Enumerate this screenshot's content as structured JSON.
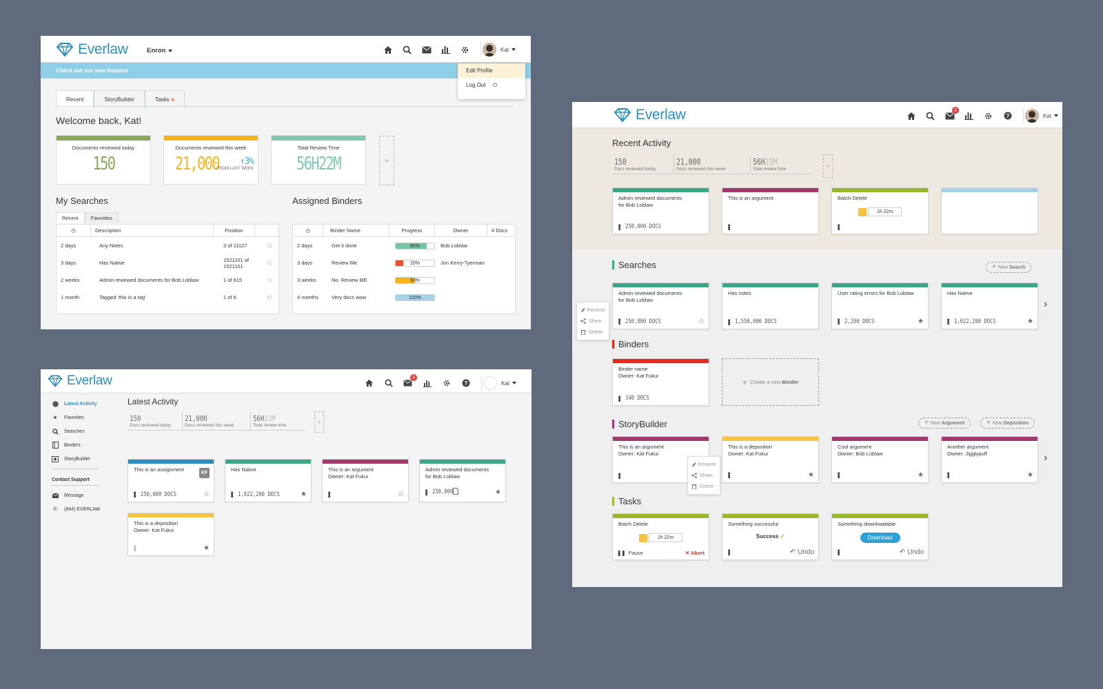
{
  "brand": {
    "name": "Everlaw",
    "color": "#2c8fbf"
  },
  "screen1": {
    "project": "Enron",
    "user": "Kat",
    "banner": "Check out our new features",
    "dropdown": [
      "Edit Profile",
      "Log Out"
    ],
    "tabs": [
      "Recent",
      "StoryBuilder",
      "Tasks"
    ],
    "welcome": "Welcome back, Kat!",
    "stats": [
      {
        "label": "Documents reviewed today",
        "value": "150",
        "color": "#8aa85a"
      },
      {
        "label": "Documents reviewed this week",
        "value": "21,000",
        "color": "#f6b41a",
        "delta": "3%",
        "delta_arrow": "↑",
        "delta_note": "FROM LAST WEEK"
      },
      {
        "label": "Total Review Time",
        "value": "56H22M",
        "color": "#7ec8b0"
      }
    ],
    "add": "+",
    "searches": {
      "title": "My Searches",
      "tabs": [
        "Recent",
        "Favorites"
      ],
      "headers": [
        "Description",
        "Position"
      ],
      "rows": [
        {
          "age": "2 days",
          "desc": "Any Notes",
          "pos": "3 of 11127"
        },
        {
          "age": "3 days",
          "desc": "Has Native",
          "pos": "1521101 of 1521101"
        },
        {
          "age": "2 weeks",
          "desc": "Admin reviewed documents for Bob Loblaw",
          "pos": "1 of 615"
        },
        {
          "age": "1 month",
          "desc": "Tagged 'this is a tag'",
          "pos": "1 of 6"
        }
      ]
    },
    "binders": {
      "title": "Assigned Binders",
      "headers": [
        "Binder Name",
        "Progress",
        "Owner",
        "# Docs"
      ],
      "rows": [
        {
          "age": "2 days",
          "name": "Get it done",
          "progress": 80,
          "progress_label": "80%",
          "color": "#74c6a3",
          "owner": "Bob Loblaw"
        },
        {
          "age": "3 days",
          "name": "Review Me",
          "progress": 20,
          "progress_label": "20%",
          "color": "#e8532f",
          "owner": "Jon Kerry-Tyerman"
        },
        {
          "age": "3 weeks",
          "name": "No, Review ME",
          "progress": 50,
          "progress_label": "50%",
          "color": "#f6b41a",
          "owner": ""
        },
        {
          "age": "4 months",
          "name": "Very docs wow",
          "progress": 100,
          "progress_label": "100%",
          "color": "#a7d3ea",
          "owner": ""
        }
      ]
    }
  },
  "screen2": {
    "user": "Kat",
    "mail_badge": "3",
    "nav": [
      "Latest Activity",
      "Favorites",
      "Searches",
      "Binders",
      "StoryBuilder"
    ],
    "contact": {
      "title": "Contact Support",
      "message": "Message",
      "phone": "(844) EVERLAW"
    },
    "title": "Latest Activity",
    "stats": [
      {
        "n": "150",
        "t": "Docs reviewed today"
      },
      {
        "n": "21,000",
        "t": "Docs reviewed this week"
      },
      {
        "n_dark": "56H",
        "n_light": "22M",
        "t": "Total review time"
      }
    ],
    "add": "+",
    "cards": [
      {
        "title": "This is an assignment",
        "sub": "",
        "color": "#2c8fbf",
        "docs": "250,000 DOCS",
        "badge": "KF",
        "star": "☆"
      },
      {
        "title": "Has Native",
        "sub": "",
        "color": "#3aa886",
        "docs": "1,022,200 DOCS",
        "star": "★"
      },
      {
        "title": "This is an argument",
        "sub": "Owner: Kat Fukui",
        "color": "#a2396d",
        "docs": "",
        "star": "☆"
      },
      {
        "title": "Admin reviewed documents",
        "sub": "for Bob Loblaw",
        "color": "#3aa886",
        "docs": "250,000",
        "star": "★"
      },
      {
        "title": "This is a deposition",
        "sub": "Owner: Kat Fukui",
        "color": "#f6c343",
        "docs": "",
        "star": "★"
      }
    ]
  },
  "screen3": {
    "user": "Kat",
    "mail_badge": "3",
    "recent_title": "Recent Activity",
    "stats": [
      {
        "n": "150",
        "t": "Docs reviewed today"
      },
      {
        "n": "21,000",
        "t": "Docs reviewed this week"
      },
      {
        "n_dark": "56H",
        "n_light": "22M",
        "t": "Total review time"
      }
    ],
    "add": "+",
    "recent_cards": [
      {
        "title": "Admin reviewed documents",
        "sub": "for Bob Loblaw",
        "color": "#3aa886",
        "docs": "250,000 DOCS"
      },
      {
        "title": "This is an argument",
        "sub": "",
        "color": "#a2396d",
        "docs": ""
      },
      {
        "title": "Batch Delete",
        "sub": "",
        "color": "#98b82a",
        "timer": "1h 22m"
      },
      {
        "title": "",
        "sub": "",
        "color": "#a7d3ea"
      }
    ],
    "searches": {
      "title": "Searches",
      "color": "#3aa886",
      "new_plus": "+",
      "new_pre": "New",
      "new_bold": "Search",
      "cards": [
        {
          "title": "Admin reviewed documents",
          "sub": "for Bob Loblaw",
          "docs": "250,000 DOCS",
          "star": "☆"
        },
        {
          "title": "Has notes",
          "sub": "",
          "docs": "1,550,000 DOCS",
          "star": ""
        },
        {
          "title": "User rating errors for Bob Loblaw",
          "sub": "",
          "docs": "2,200 DOCS",
          "star": "★"
        },
        {
          "title": "Has Native",
          "sub": "",
          "docs": "1,022,200 DOCS",
          "star": "★"
        }
      ]
    },
    "context_menu": [
      "Rename",
      "Share",
      "Delete"
    ],
    "binders": {
      "title": "Binders",
      "color": "#e02b20",
      "card": {
        "title": "Binder name",
        "sub": "Owner: Kat Fukui",
        "docs": "340 DOCS"
      },
      "create_plus": "+",
      "create_pre": "Create a new",
      "create_bold": "Binder"
    },
    "storybuilder": {
      "title": "StoryBuilder",
      "color": "#a2396d",
      "new_argument_pre": "New",
      "new_argument_bold": "Argument",
      "new_deposition_pre": "New",
      "new_deposition_bold": "Deposition",
      "cards": [
        {
          "title": "This is an argument",
          "sub": "Owner: Kat Fukui",
          "color": "#a2396d",
          "star": ""
        },
        {
          "title": "This is a deposition",
          "sub": "Owner: Kat Fukui",
          "color": "#f6c343",
          "star": "★"
        },
        {
          "title": "Cool argument",
          "sub": "Owner: Bob Loblaw",
          "color": "#a2396d",
          "star": "★"
        },
        {
          "title": "Another argument",
          "sub": "Owner: Jigglypuff",
          "color": "#a2396d",
          "star": "★"
        }
      ]
    },
    "tasks": {
      "title": "Tasks",
      "color": "#98b82a",
      "cards": [
        {
          "title": "Batch Delete",
          "timer": "1h 22m",
          "pause": "Pause",
          "abort": "Abort"
        },
        {
          "title": "Something successful",
          "status": "Success",
          "undo": "Undo"
        },
        {
          "title": "Something downloadable",
          "button": "Download",
          "undo": "Undo"
        }
      ]
    },
    "next": "›"
  }
}
